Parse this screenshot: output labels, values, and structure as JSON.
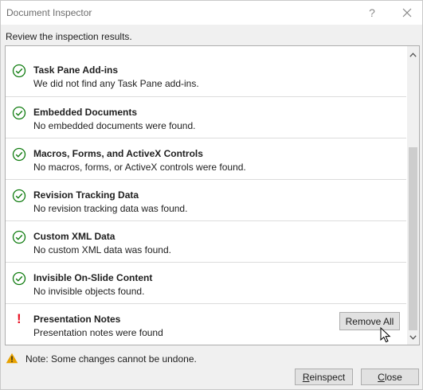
{
  "window": {
    "title": "Document Inspector",
    "help_label": "?"
  },
  "instructions": "Review the inspection results.",
  "results": [
    {
      "status": "ok",
      "title": "Task Pane Add-ins",
      "description": "We did not find any Task Pane add-ins."
    },
    {
      "status": "ok",
      "title": "Embedded Documents",
      "description": "No embedded documents were found."
    },
    {
      "status": "ok",
      "title": "Macros, Forms, and ActiveX Controls",
      "description": "No macros, forms, or ActiveX controls were found."
    },
    {
      "status": "ok",
      "title": "Revision Tracking Data",
      "description": "No revision tracking data was found."
    },
    {
      "status": "ok",
      "title": "Custom XML Data",
      "description": "No custom XML data was found."
    },
    {
      "status": "ok",
      "title": "Invisible On-Slide Content",
      "description": "No invisible objects found."
    },
    {
      "status": "warning",
      "title": "Presentation Notes",
      "description": "Presentation notes were found",
      "warning_mark": "!",
      "action_label": "Remove All"
    }
  ],
  "note": {
    "text": "Note: Some changes cannot be undone.",
    "icon": "warning-triangle-icon"
  },
  "buttons": {
    "reinspect_first": "R",
    "reinspect_rest": "einspect",
    "close_first": "C",
    "close_rest": "lose"
  },
  "colors": {
    "check_green": "#107c10",
    "warning_red": "#e81123",
    "note_orange": "#e8a200"
  }
}
